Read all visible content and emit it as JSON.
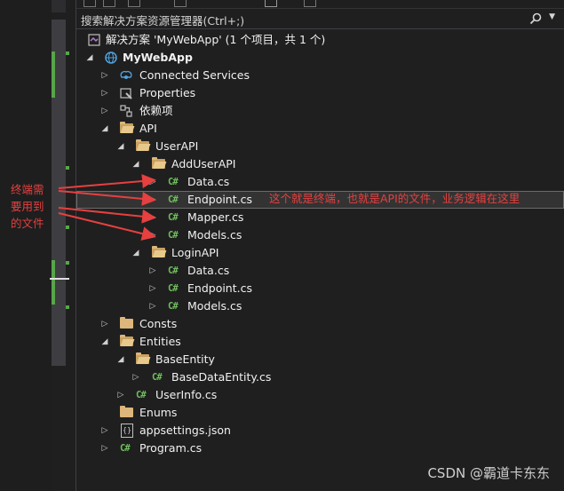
{
  "search": {
    "placeholder": "搜索解决方案资源管理器(Ctrl+;)"
  },
  "tree": {
    "solution": "解决方案 'MyWebApp' (1 个项目，共 1 个)",
    "project": "MyWebApp",
    "connected_services": "Connected Services",
    "properties": "Properties",
    "dependencies": "依赖项",
    "api": "API",
    "userapi": "UserAPI",
    "adduserapi": "AddUserAPI",
    "add_data": "Data.cs",
    "add_endpoint": "Endpoint.cs",
    "add_mapper": "Mapper.cs",
    "add_models": "Models.cs",
    "loginapi": "LoginAPI",
    "login_data": "Data.cs",
    "login_endpoint": "Endpoint.cs",
    "login_models": "Models.cs",
    "consts": "Consts",
    "entities": "Entities",
    "baseentity": "BaseEntity",
    "basedataentity": "BaseDataEntity.cs",
    "userinfo": "UserInfo.cs",
    "enums": "Enums",
    "appsettings": "appsettings.json",
    "program": "Program.cs"
  },
  "icons": {
    "csharp": "C#",
    "json": "{}"
  },
  "annotations": {
    "left_line1": "终端需",
    "left_line2": "要用到",
    "left_line3": "的文件",
    "right": "这个就是终端，也就是API的文件，业务逻辑在这里",
    "color": "#e64040"
  },
  "watermark": "CSDN @霸道卡东东"
}
